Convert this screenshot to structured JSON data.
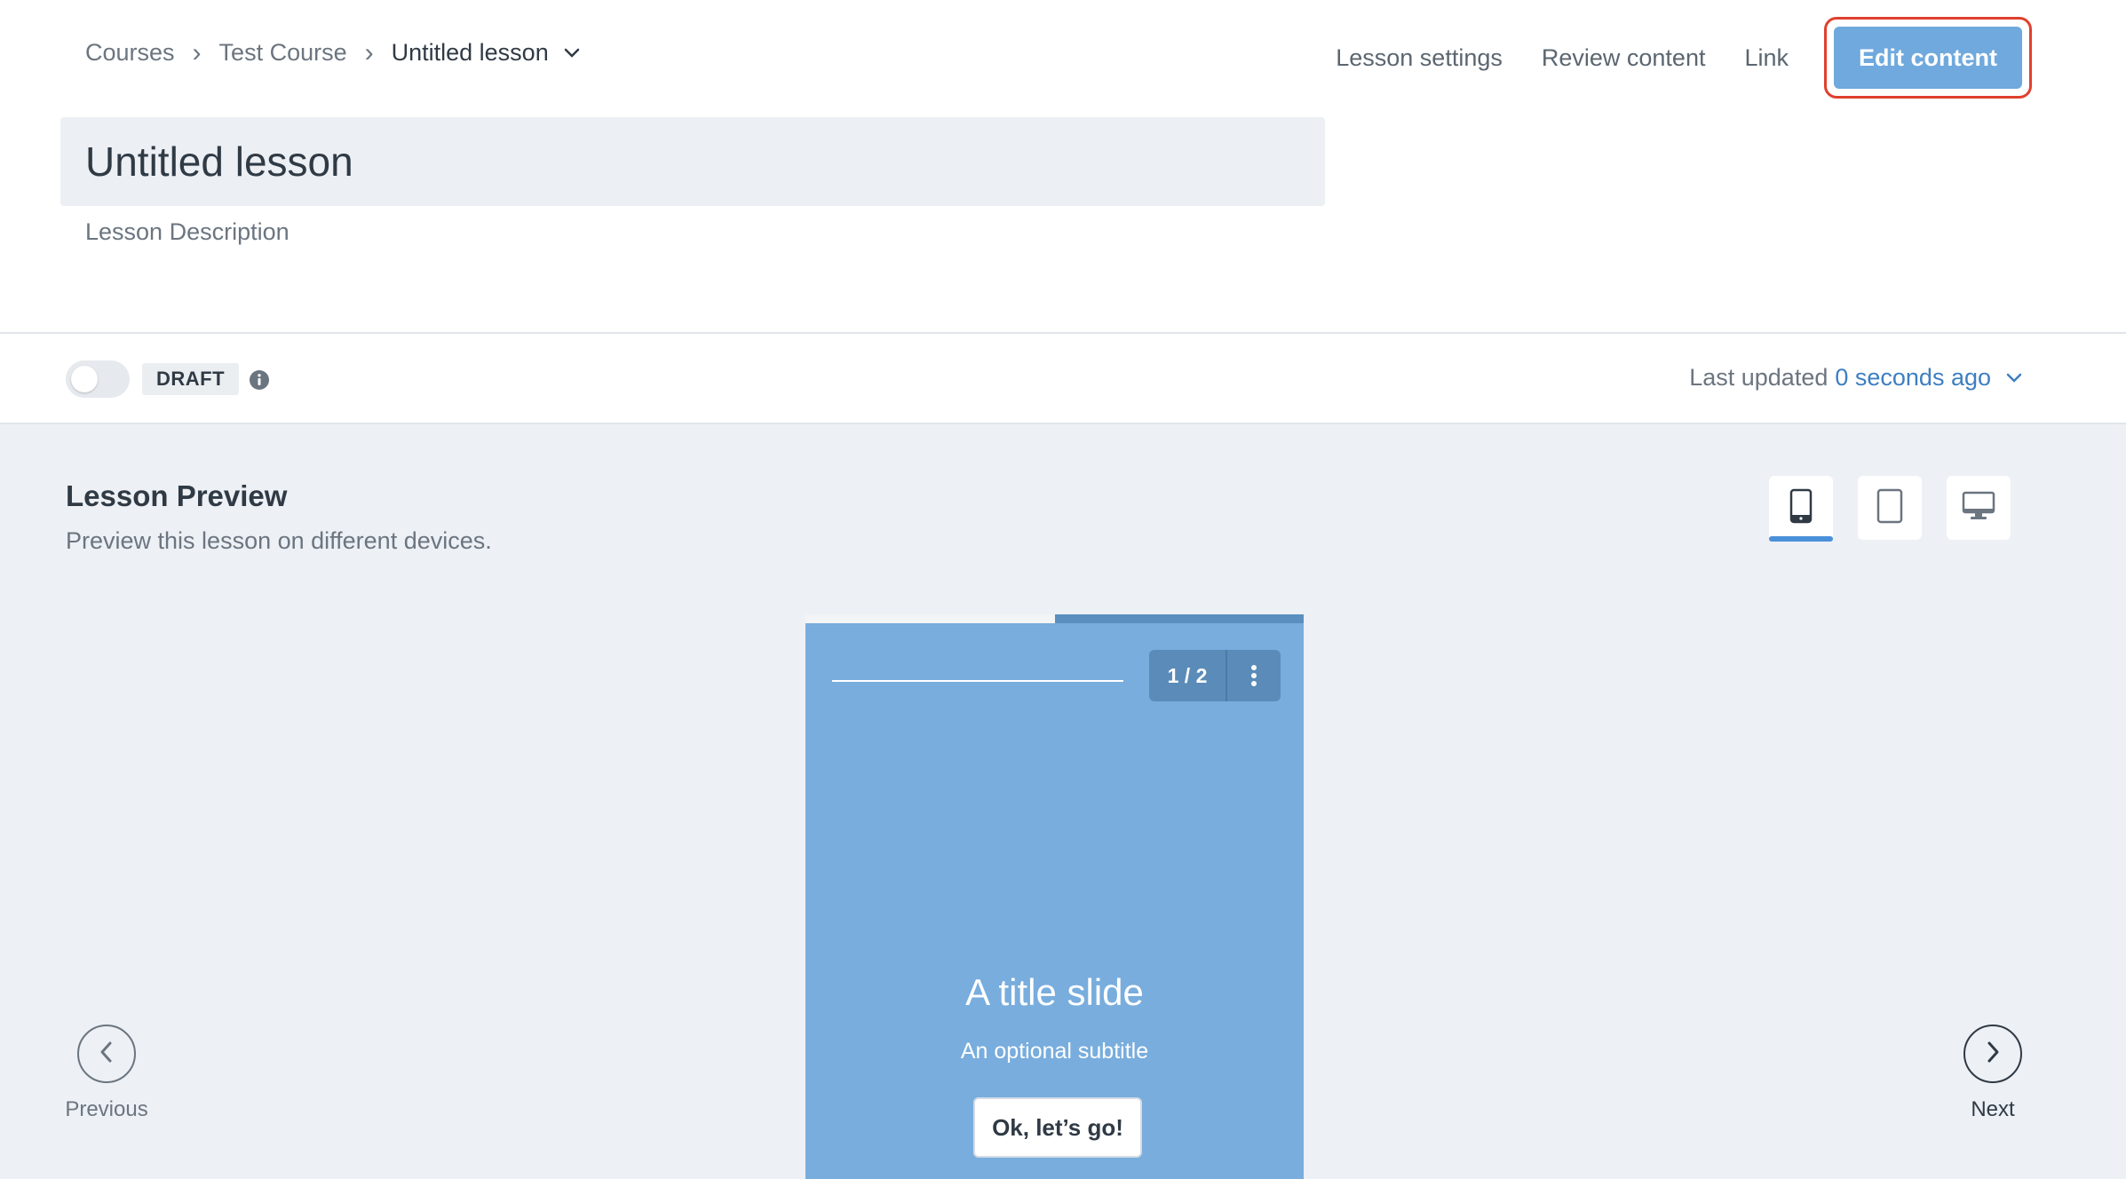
{
  "breadcrumb": {
    "items": [
      {
        "label": "Courses"
      },
      {
        "label": "Test Course"
      },
      {
        "label": "Untitled lesson"
      }
    ]
  },
  "header": {
    "lesson_settings": "Lesson settings",
    "review_content": "Review content",
    "link": "Link",
    "edit_content": "Edit content"
  },
  "lesson": {
    "title": "Untitled lesson",
    "description_placeholder": "Lesson Description"
  },
  "status": {
    "badge": "DRAFT",
    "published": false,
    "last_updated_label": "Last updated",
    "last_updated_value": "0 seconds ago"
  },
  "preview": {
    "title": "Lesson Preview",
    "subtitle": "Preview this lesson on different devices.",
    "devices": [
      "phone-icon",
      "tablet-icon",
      "desktop-icon"
    ],
    "active_device": "phone",
    "slide": {
      "counter": "1 / 2",
      "progress": 0.5,
      "title": "A title slide",
      "subtitle": "An optional subtitle",
      "button": "Ok, let’s go!"
    },
    "nav": {
      "previous": "Previous",
      "next": "Next"
    }
  },
  "colors": {
    "accent": "#6fa9dd",
    "slide_bg": "#78addd",
    "highlight_outline": "#e0402e",
    "link_blue": "#3d7fc1"
  }
}
